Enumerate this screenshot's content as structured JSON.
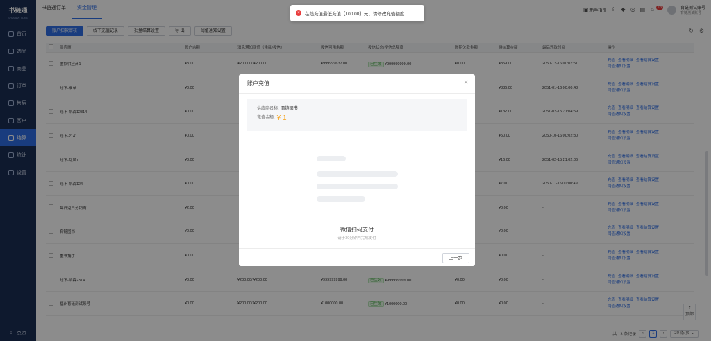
{
  "sidebar": {
    "logo_title": "书链通",
    "logo_sub": "SHULIAN TONG",
    "items": [
      {
        "label": "首页"
      },
      {
        "label": "选品"
      },
      {
        "label": "商品"
      },
      {
        "label": "订单"
      },
      {
        "label": "售后"
      },
      {
        "label": "客户"
      },
      {
        "label": "结算"
      },
      {
        "label": "统计"
      },
      {
        "label": "设置"
      }
    ],
    "bottom_label": "总览"
  },
  "header": {
    "tabs": [
      {
        "label": "书链通订单"
      },
      {
        "label": "资金管理"
      }
    ],
    "guide_label": "新手指引",
    "badge": "13",
    "user_name": "育链测试账号",
    "user_sub": "育链测试账号"
  },
  "toolbar": {
    "b1": "账户扣款审核",
    "b2": "线下充值记录",
    "b3": "批量结算设置",
    "b4": "导 出",
    "b5": "阈值通知设置"
  },
  "table": {
    "headers": [
      "供应商",
      "账户余额",
      "消息通知阈值（余额/授信）",
      "授信可用余额",
      "授信状态/授信总额度",
      "账期欠款金额",
      "待结算金额",
      "最后还款时间",
      "操作"
    ],
    "rows": [
      {
        "name": "虚拟供应商1",
        "balance": "¥3.00",
        "threshold": "¥200.00/ ¥200.00",
        "credit_avail": "¥999999637.00",
        "status": "已生效",
        "credit_total": "¥999999999.00",
        "debt": "¥0.00",
        "pending": "¥359.00",
        "last": "2050-12-16 00:07:51"
      },
      {
        "name": "线下-推单",
        "balance": "¥0.00",
        "threshold": "",
        "credit_avail": "",
        "status": "",
        "credit_total": "",
        "debt": "",
        "pending": "¥336.00",
        "last": "2051-01-16 00:00:43"
      },
      {
        "name": "线下-凯森12314",
        "balance": "¥0.00",
        "threshold": "",
        "credit_avail": "",
        "status": "",
        "credit_total": "",
        "debt": "",
        "pending": "¥132.00",
        "last": "2051-02-15 21:04:59"
      },
      {
        "name": "线下-2141",
        "balance": "¥0.00",
        "threshold": "",
        "credit_avail": "",
        "status": "",
        "credit_total": "",
        "debt": "",
        "pending": "¥50.00",
        "last": "2050-10-16 00:02:30"
      },
      {
        "name": "线下-乱风1",
        "balance": "¥0.00",
        "threshold": "",
        "credit_avail": "",
        "status": "",
        "credit_total": "",
        "debt": "",
        "pending": "¥16.00",
        "last": "2051-02-15 21:02:06"
      },
      {
        "name": "线下-凯森124",
        "balance": "¥0.00",
        "threshold": "",
        "credit_avail": "",
        "status": "",
        "credit_total": "",
        "debt": "",
        "pending": "¥7.00",
        "last": "2050-11-15 00:00:49"
      },
      {
        "name": "每日返日分销商",
        "balance": "¥2.00",
        "threshold": "",
        "credit_avail": "",
        "status": "",
        "credit_total": "",
        "debt": "",
        "pending": "¥0.00",
        "last": "-"
      },
      {
        "name": "育链图书",
        "balance": "¥0.00",
        "threshold": "",
        "credit_avail": "",
        "status": "",
        "credit_total": "",
        "debt": "",
        "pending": "¥0.00",
        "last": "-"
      },
      {
        "name": "重书捕手",
        "balance": "¥0.00",
        "threshold": "",
        "credit_avail": "",
        "status": "",
        "credit_total": "",
        "debt": "",
        "pending": "¥0.00",
        "last": "-"
      },
      {
        "name": "线下-凯森2314",
        "balance": "¥0.00",
        "threshold": "¥200.00/ ¥200.00",
        "credit_avail": "¥999999999.00",
        "status": "已生效",
        "credit_total": "¥999999999.00",
        "debt": "¥0.00",
        "pending": "¥0.00",
        "last": "-"
      },
      {
        "name": "福州育砥测试账号",
        "balance": "¥0.00",
        "threshold": "¥200.00/ ¥200.00",
        "credit_avail": "¥1000000.00",
        "status": "已生效",
        "credit_total": "¥1000000.00",
        "debt": "¥0.00",
        "pending": "¥0.00",
        "last": "-"
      }
    ],
    "op_recharge": "充值",
    "op_detail": "查看明细",
    "op_settle": "查看结算设置",
    "op_notify": "阈值通知设置"
  },
  "pager": {
    "total": "共 13 条记录",
    "page": "1",
    "size": "20 条/页"
  },
  "top_label": "顶部",
  "toast": {
    "message": "在线充值最低充值【100.00】元，请修改充值额度"
  },
  "modal": {
    "title": "账户充值",
    "supplier_label": "供应商名称:",
    "supplier_value": "育链图书",
    "amount_label": "充值金额:",
    "amount_value": "¥ 1",
    "pay_title": "微信扫码支付",
    "pay_sub": "请于30分钟内完成支付",
    "prev_label": "上一步"
  }
}
